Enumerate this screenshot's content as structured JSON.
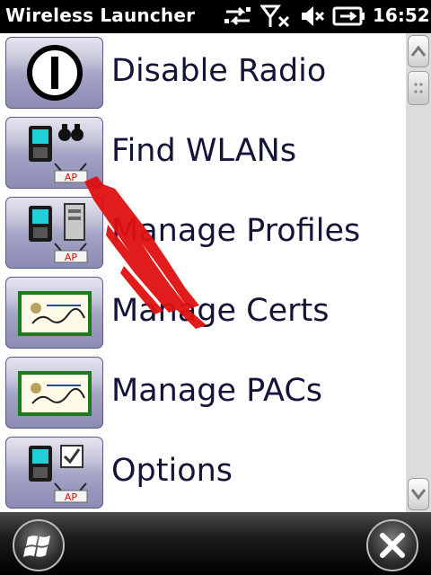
{
  "statusbar": {
    "title": "Wireless Launcher",
    "clock": "16:52",
    "icons": [
      "data-sync-icon",
      "no-signal-icon",
      "speaker-muted-icon",
      "battery-charging-icon"
    ]
  },
  "menu": {
    "items": [
      {
        "label": "Disable Radio",
        "icon": "power-icon"
      },
      {
        "label": "Find WLANs",
        "icon": "find-wlan-icon"
      },
      {
        "label": "Manage Profiles",
        "icon": "profiles-icon"
      },
      {
        "label": "Manage Certs",
        "icon": "certificate-icon"
      },
      {
        "label": "Manage PACs",
        "icon": "pac-certificate-icon"
      },
      {
        "label": "Options",
        "icon": "options-icon"
      }
    ]
  },
  "tile_badges": {
    "find_wlans": "AP",
    "manage_profiles": "AP",
    "options": "AP"
  },
  "bottombar": {
    "left_icon": "windows-start-icon",
    "right_icon": "close-icon"
  },
  "annotation": {
    "color": "#e01010",
    "icon": "red-arrow-annotation"
  }
}
